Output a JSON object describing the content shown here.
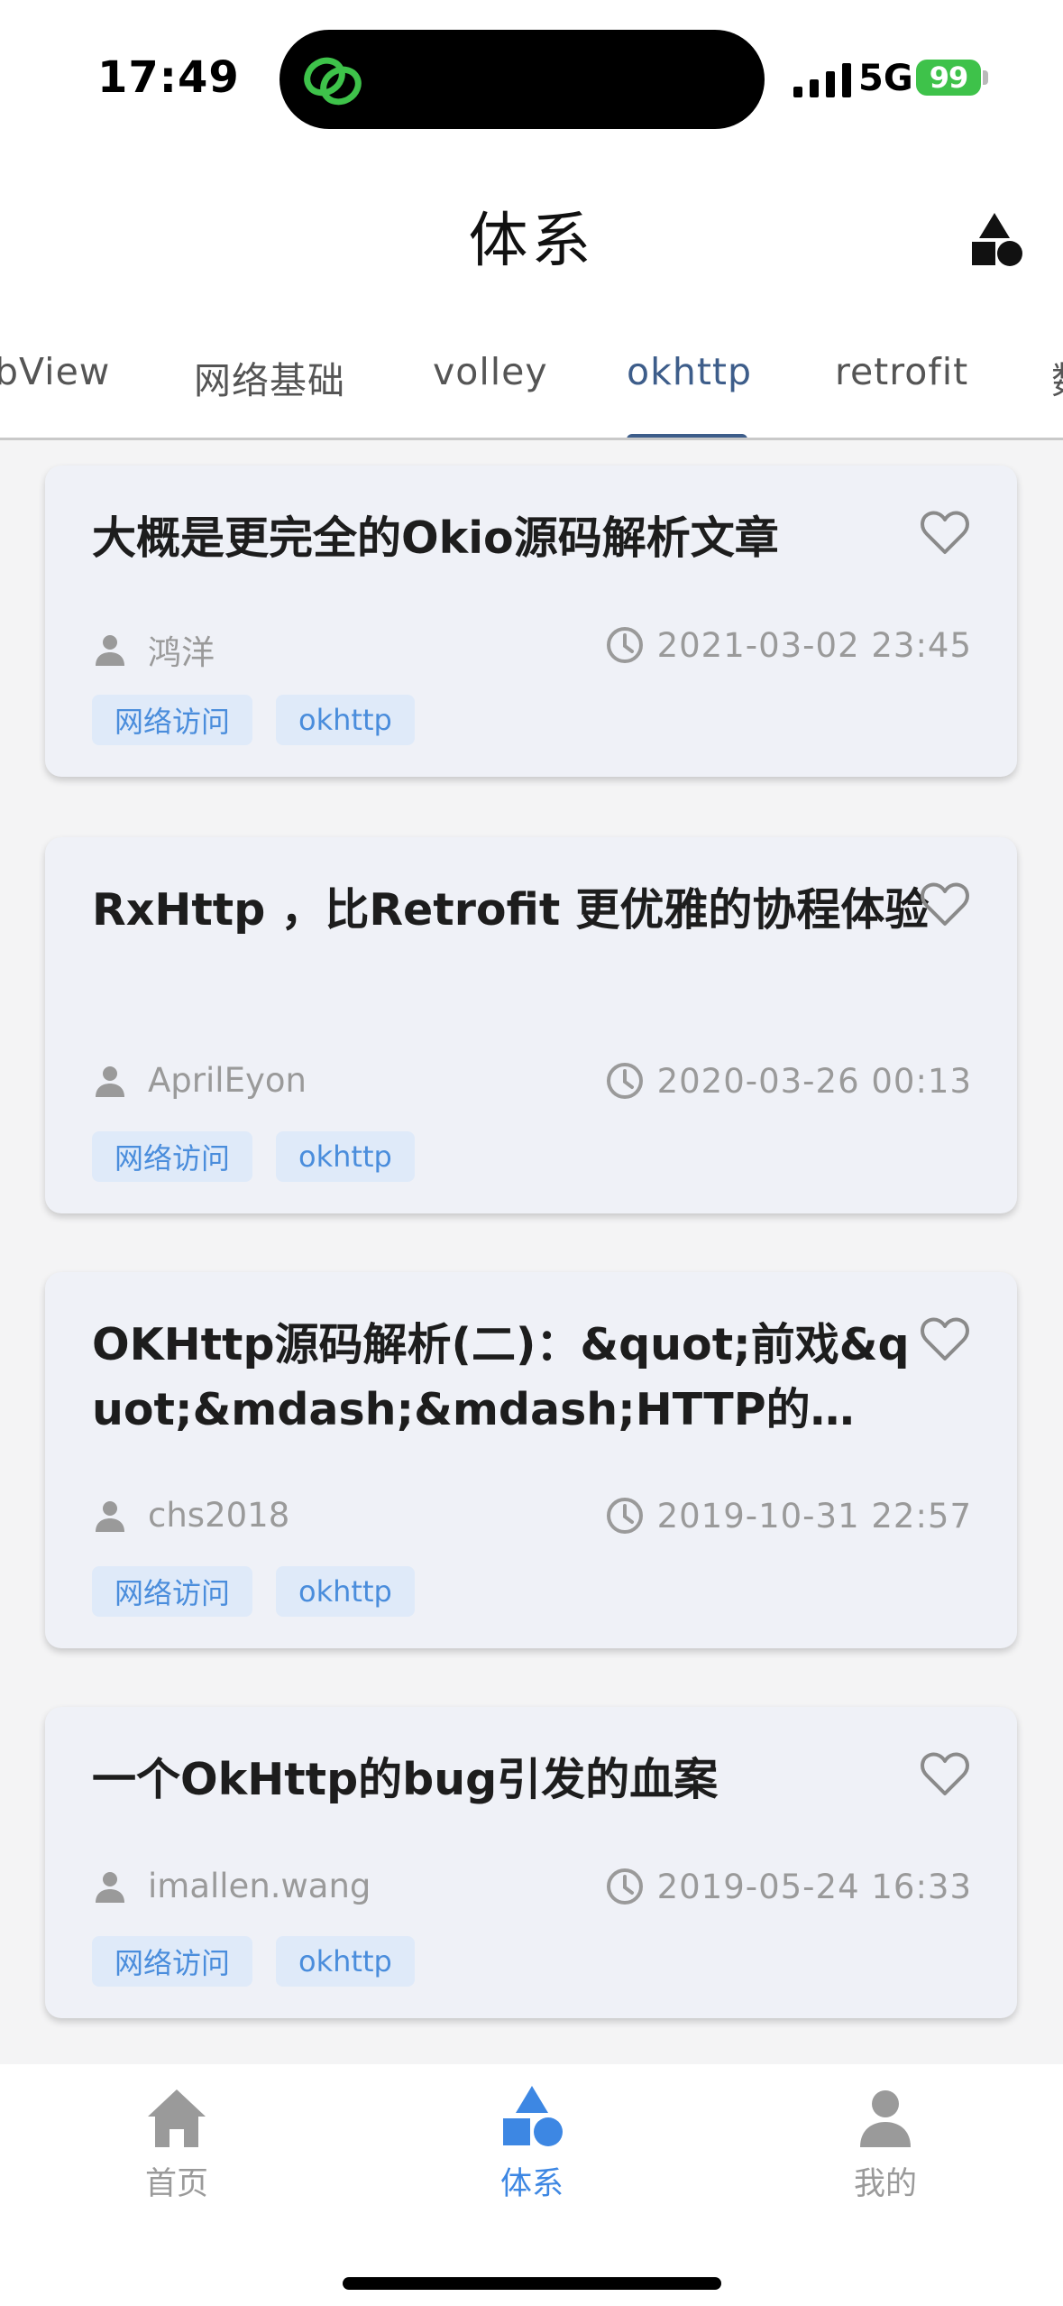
{
  "status": {
    "time": "17:49",
    "network": "5G",
    "battery": "99"
  },
  "header": {
    "title": "体系"
  },
  "tabs": [
    {
      "label": "bView",
      "active": false
    },
    {
      "label": "网络基础",
      "active": false
    },
    {
      "label": "volley",
      "active": false
    },
    {
      "label": "okhttp",
      "active": true
    },
    {
      "label": "retrofit",
      "active": false
    },
    {
      "label": "数",
      "active": false
    }
  ],
  "articles": [
    {
      "title": "大概是更完全的Okio源码解析文章",
      "author": "鸿洋",
      "time": "2021-03-02 23:45",
      "tags": [
        "网络访问",
        "okhttp"
      ]
    },
    {
      "title": "RxHttp ，比Retrofit 更优雅的协程体验",
      "author": "AprilEyon",
      "time": "2020-03-26 00:13",
      "tags": [
        "网络访问",
        "okhttp"
      ]
    },
    {
      "title": "OKHttp源码解析(二)：&quot;前戏&quot;&mdash;&mdash;HTTP的…",
      "author": "chs2018",
      "time": "2019-10-31 22:57",
      "tags": [
        "网络访问",
        "okhttp"
      ]
    },
    {
      "title": "一个OkHttp的bug引发的血案",
      "author": "imallen.wang",
      "time": "2019-05-24 16:33",
      "tags": [
        "网络访问",
        "okhttp"
      ]
    }
  ],
  "bottom_nav": [
    {
      "label": "首页",
      "icon": "home-icon",
      "active": false
    },
    {
      "label": "体系",
      "icon": "shapes-icon",
      "active": true
    },
    {
      "label": "我的",
      "icon": "person-icon",
      "active": false
    }
  ],
  "colors": {
    "accent": "#3d5d8a",
    "nav_active": "#3d87e3",
    "tag_text": "#4a8ddc",
    "tag_bg": "#dfeaf9",
    "card_bg": "#eff1f7",
    "battery": "#3ec24a"
  }
}
